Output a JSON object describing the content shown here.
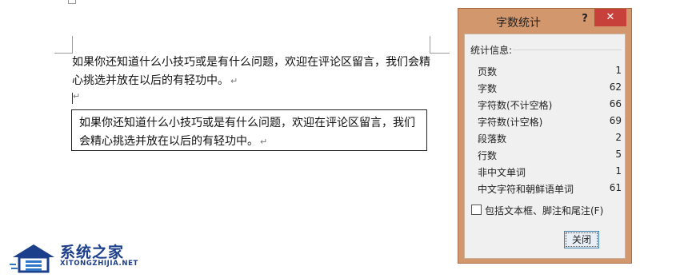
{
  "document": {
    "paragraph_1": "如果你还知道什么小技巧或是有什么问题，欢迎在评论区留言，我们会精心挑选并放在以后的有轻功中。",
    "paragraph_1_line_1": "如果你还知道什么小技巧或是有什么问题，欢迎在评论区留言，我们会精",
    "paragraph_1_line_2": "心挑选并放在以后的有轻功中。",
    "textbox_line_1": "如果你还知道什么小技巧或是有什么问题，欢迎在评论区留言，我们",
    "textbox_line_2": "会精心挑选并放在以后的有轻功中。",
    "return_mark": "↵"
  },
  "dialog": {
    "title": "字数统计",
    "help_label": "?",
    "close_label": "✕",
    "group_label": "统计信息:",
    "stats": [
      {
        "label": "页数",
        "value": "1"
      },
      {
        "label": "字数",
        "value": "62"
      },
      {
        "label": "字符数(不计空格)",
        "value": "66"
      },
      {
        "label": "字符数(计空格)",
        "value": "69"
      },
      {
        "label": "段落数",
        "value": "2"
      },
      {
        "label": "行数",
        "value": "5"
      },
      {
        "label": "非中文单词",
        "value": "1"
      },
      {
        "label": "中文字符和朝鲜语单词",
        "value": "61"
      }
    ],
    "checkbox_label": "包括文本框、脚注和尾注(F)",
    "checkbox_checked": false,
    "close_button_label": "关闭"
  },
  "watermark": {
    "title": "系统之家",
    "subtitle": "XITONGZHIJIA.NET"
  },
  "colors": {
    "dialog_frame": "#d3976d",
    "close_button": "#c7403a",
    "watermark": "#1b3f8a"
  }
}
